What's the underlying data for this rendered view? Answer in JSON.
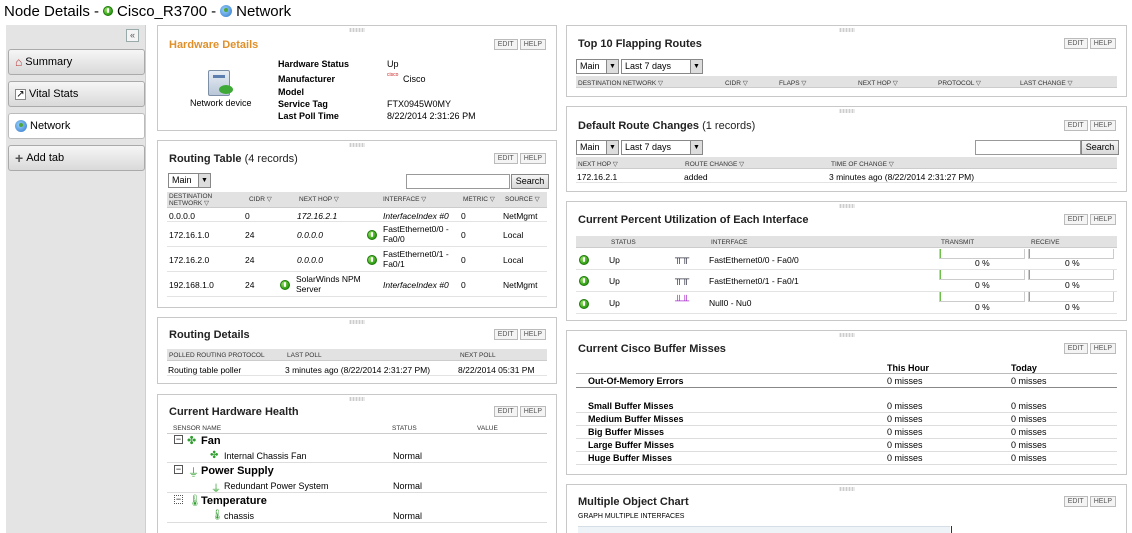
{
  "page": {
    "title_prefix": "Node Details -",
    "node_name": "Cisco_R3700",
    "title_sep": "-",
    "view_name": "Network"
  },
  "sidebar": {
    "collapse_icon": "«",
    "tabs": [
      {
        "label": "Summary",
        "icon": "house-icon"
      },
      {
        "label": "Vital Stats",
        "icon": "chart-icon"
      },
      {
        "label": "Network",
        "icon": "globe-icon"
      },
      {
        "label": "Add tab",
        "icon": "plus-icon"
      }
    ]
  },
  "common": {
    "edit": "EDIT",
    "help": "HELP",
    "search": "Search",
    "main": "Main",
    "last7": "Last 7 days"
  },
  "hardware_details": {
    "title": "Hardware Details",
    "device_label": "Network device",
    "labels": [
      "Hardware Status",
      "Manufacturer",
      "Model",
      "Service Tag",
      "Last Poll Time"
    ],
    "values": [
      "Up",
      "Cisco",
      "",
      "FTX0945W0MY",
      "8/22/2014 2:31:26 PM"
    ],
    "brand_logo_text": "cisco"
  },
  "routing_table": {
    "title": "Routing Table",
    "count": "(4 records)",
    "headers": [
      "DESTINATION NETWORK ▽",
      "CIDR ▽",
      "NEXT HOP ▽",
      "INTERFACE ▽",
      "METRIC ▽",
      "SOURCE ▽"
    ],
    "rows": [
      {
        "dest": "0.0.0.0",
        "cidr": "0",
        "next_hop": "172.16.2.1",
        "interface": "InterfaceIndex #0",
        "metric": "0",
        "source": "NetMgmt"
      },
      {
        "dest": "172.16.1.0",
        "cidr": "24",
        "next_hop": "0.0.0.0",
        "interface": "FastEthernet0/0 - Fa0/0",
        "metric": "0",
        "source": "Local"
      },
      {
        "dest": "172.16.2.0",
        "cidr": "24",
        "next_hop": "0.0.0.0",
        "interface": "FastEthernet0/1 - Fa0/1",
        "metric": "0",
        "source": "Local"
      },
      {
        "dest": "192.168.1.0",
        "cidr": "24",
        "next_hop": "SolarWinds NPM Server",
        "interface": "InterfaceIndex #0",
        "metric": "0",
        "source": "NetMgmt"
      }
    ]
  },
  "routing_details": {
    "title": "Routing Details",
    "headers": [
      "POLLED ROUTING PROTOCOL",
      "LAST POLL",
      "NEXT POLL"
    ],
    "row": [
      "Routing table poller",
      "3 minutes ago (8/22/2014 2:31:27 PM)",
      "8/22/2014 05:31 PM"
    ]
  },
  "hardware_health": {
    "title": "Current Hardware Health",
    "headers": [
      "SENSOR NAME",
      "STATUS",
      "VALUE"
    ],
    "groups": [
      {
        "name": "Fan",
        "toggle": "−",
        "sensor": "Internal Chassis Fan",
        "status": "Normal"
      },
      {
        "name": "Power Supply",
        "toggle": "−",
        "sensor": "Redundant Power System",
        "status": "Normal"
      },
      {
        "name": "Temperature",
        "toggle": "−",
        "sensor": "chassis",
        "status": "Normal"
      }
    ]
  },
  "flapping": {
    "title": "Top 10 Flapping Routes",
    "headers": [
      "DESTINATION NETWORK ▽",
      "CIDR ▽",
      "FLAPS ▽",
      "NEXT HOP ▽",
      "PROTOCOL ▽",
      "LAST CHANGE ▽"
    ]
  },
  "default_route": {
    "title": "Default Route Changes",
    "count": "(1 records)",
    "headers": [
      "NEXT HOP ▽",
      "ROUTE CHANGE ▽",
      "TIME OF CHANGE ▽"
    ],
    "row": [
      "172.16.2.1",
      "added",
      "3 minutes ago (8/22/2014 2:31:27 PM)"
    ]
  },
  "utilization": {
    "title": "Current Percent Utilization of Each Interface",
    "headers": [
      "STATUS",
      "INTERFACE",
      "TRANSMIT",
      "RECEIVE"
    ],
    "rows": [
      {
        "status": "Up",
        "interface": "FastEthernet0/0 - Fa0/0",
        "transmit": "0 %",
        "receive": "0 %",
        "transmit_pct": 0,
        "receive_pct": 0
      },
      {
        "status": "Up",
        "interface": "FastEthernet0/1 - Fa0/1",
        "transmit": "0 %",
        "receive": "0 %",
        "transmit_pct": 0,
        "receive_pct": 0
      },
      {
        "status": "Up",
        "interface": "Null0 - Nu0",
        "transmit": "0 %",
        "receive": "0 %",
        "transmit_pct": 0,
        "receive_pct": 0
      }
    ]
  },
  "buffer": {
    "title": "Current Cisco Buffer Misses",
    "col_hour": "This Hour",
    "col_today": "Today",
    "oom": {
      "label": "Out-Of-Memory Errors",
      "hour": "0 misses",
      "today": "0 misses"
    },
    "rows": [
      {
        "label": "Small Buffer Misses",
        "hour": "0 misses",
        "today": "0 misses"
      },
      {
        "label": "Medium Buffer Misses",
        "hour": "0 misses",
        "today": "0 misses"
      },
      {
        "label": "Big Buffer Misses",
        "hour": "0 misses",
        "today": "0 misses"
      },
      {
        "label": "Large Buffer Misses",
        "hour": "0 misses",
        "today": "0 misses"
      },
      {
        "label": "Huge Buffer Misses",
        "hour": "0 misses",
        "today": "0 misses"
      }
    ]
  },
  "multi_chart": {
    "title": "Multiple Object Chart",
    "subtitle": "GRAPH MULTIPLE INTERFACES"
  }
}
